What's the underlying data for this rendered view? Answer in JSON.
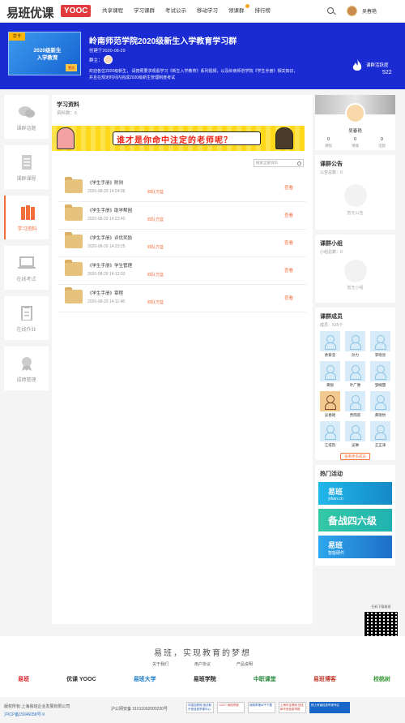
{
  "header": {
    "logo_cn": "易班优课",
    "logo_en": "YOOC",
    "nav": [
      {
        "label": "共享课程",
        "badge": false
      },
      {
        "label": "学习课群",
        "badge": false
      },
      {
        "label": "考试公示",
        "badge": false
      },
      {
        "label": "移动学习",
        "badge": false
      },
      {
        "label": "领课群",
        "badge": true
      },
      {
        "label": "排行榜",
        "badge": false
      }
    ],
    "user_name": "吴春艳"
  },
  "banner": {
    "cover_tag": "打卡",
    "cover_line1": "2020级新生",
    "cover_line2": "入学教育",
    "cover_stamp": "考试",
    "title": "岭南师范学院2020级新生入学教育学习群",
    "date": "创建于2020-08-29",
    "owner_label": "群主：",
    "description_line1": "欢迎各位2020级新生， 请按照要求观看学习《新生入学教育》系列视频，以及岭南师范学院《学生手册》相关知识，",
    "description_line2": "并且在规定时间内完成2020级新生管理制度考试",
    "activity_label": "课群活跃度",
    "activity_value": "522"
  },
  "sidebar": [
    {
      "label": "课群话题",
      "icon": "chat-bubbles-icon",
      "active": false
    },
    {
      "label": "课群课程",
      "icon": "document-icon",
      "active": false
    },
    {
      "label": "学习资料",
      "icon": "books-icon",
      "active": true
    },
    {
      "label": "在线考试",
      "icon": "laptop-icon",
      "active": false
    },
    {
      "label": "在线作业",
      "icon": "clipboard-icon",
      "active": false
    },
    {
      "label": "成绩管理",
      "icon": "medal-icon",
      "active": false
    }
  ],
  "main": {
    "title": "学习资料",
    "count": "资料数：5",
    "promo_text": "谁才是你命中注定的老师呢？",
    "search_placeholder": "搜索全部资料",
    "files": [
      {
        "name": "《学生手册》附则",
        "date": "2020-08-29 14:24:06",
        "tag": "四队方篮",
        "action": "查看"
      },
      {
        "name": "《学生手册》助学帮困",
        "date": "2020-08-29 14:23:40",
        "tag": "四队方篮",
        "action": "查看"
      },
      {
        "name": "《学生手册》评优奖励",
        "date": "2020-08-29 14:23:25",
        "tag": "四队方篮",
        "action": "查看"
      },
      {
        "name": "《学生手册》学生管理",
        "date": "2020-08-29 14:12:03",
        "tag": "四队方篮",
        "action": "查看"
      },
      {
        "name": "《学生手册》章程",
        "date": "2020-08-29 14:11:48",
        "tag": "四队方篮",
        "action": "查看"
      }
    ]
  },
  "right": {
    "profile_name": "吴春艳",
    "stats": [
      {
        "value": "0",
        "label": "课程"
      },
      {
        "value": "0",
        "label": "课群"
      },
      {
        "value": "0",
        "label": "话题"
      }
    ],
    "notice_title": "课群公告",
    "notice_count": "公告总数：0",
    "notice_empty": "暂无公告",
    "group_title": "课群小组",
    "group_count": "小组总数：0",
    "group_empty": "暂无小组",
    "members_title": "课群成员",
    "members_count": "成员：515个",
    "members": [
      {
        "name": "余紫莹",
        "photo": false
      },
      {
        "name": "孙力",
        "photo": false
      },
      {
        "name": "李晓亮",
        "photo": false
      },
      {
        "name": "黄锐",
        "photo": false
      },
      {
        "name": "叶广惠",
        "photo": false
      },
      {
        "name": "邹娴慧",
        "photo": false
      },
      {
        "name": "吴春艳",
        "photo": true
      },
      {
        "name": "贾雨容",
        "photo": false
      },
      {
        "name": "黄晓怡",
        "photo": false
      },
      {
        "name": "江培凯",
        "photo": false
      },
      {
        "name": "吴琳",
        "photo": false
      },
      {
        "name": "王正泽",
        "photo": false
      }
    ],
    "members_more": "查看更多成员",
    "hot_title": "热门活动",
    "hot": [
      {
        "label": "易班",
        "sub": "yiban.cn"
      },
      {
        "label": "备战四六级",
        "sub": ""
      },
      {
        "label": "易班",
        "sub": "智能硬件"
      }
    ],
    "qr_label": "扫码下载易班"
  },
  "footer": {
    "slogan": "易班，实现教育的梦想",
    "links": [
      "关于我们",
      "用户协议",
      "产品说明"
    ],
    "partners": [
      {
        "label": "易班",
        "color": "#d8262a"
      },
      {
        "label": "优课 YOOC",
        "color": "#333333"
      },
      {
        "label": "易班大学",
        "color": "#1a7bc8"
      },
      {
        "label": "易班学院",
        "color": "#222222"
      },
      {
        "label": "中职课堂",
        "color": "#2b8a3e"
      },
      {
        "label": "易班博客",
        "color": "#c0392b"
      },
      {
        "label": "校桃树",
        "color": "#3c9a3c"
      }
    ],
    "copyright": "版权所有:上海易班企业发展有限公司",
    "icp": "沪ICP备15046058号-9",
    "beian": "沪公网安备 31011002000230号",
    "certs": [
      {
        "label": "中国互联网 违法和不良信息举报中心",
        "style": "normal"
      },
      {
        "label": "12377 网络举报",
        "style": "red"
      },
      {
        "label": "网络举报APP下载",
        "style": "normal"
      },
      {
        "label": "上海市互联网 违法和不良信息举报",
        "style": "red"
      },
      {
        "label": "网上有害信息举报专区",
        "style": "wide"
      }
    ]
  }
}
